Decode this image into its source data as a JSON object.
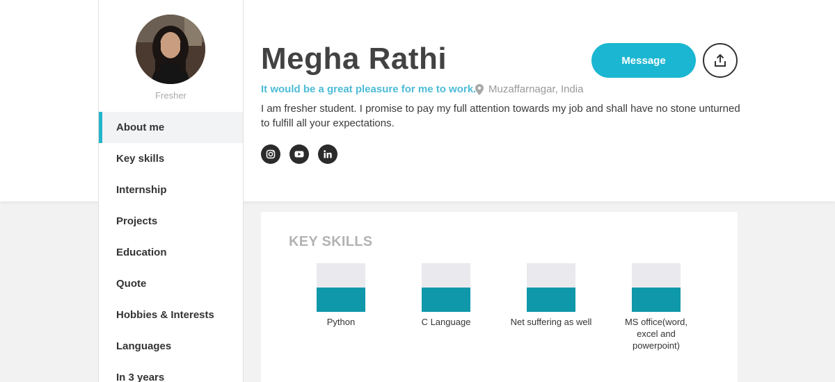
{
  "profile": {
    "status": "Fresher",
    "name": "Megha Rathi",
    "tagline": "It would be a great pleasure for me to work.",
    "location": "Muzaffarnagar, India",
    "bio": "I am fresher student. I promise to pay my full attention towards my job and shall have no stone unturned to fulfill all your expectations."
  },
  "actions": {
    "message_label": "Message"
  },
  "socials": [
    "instagram-icon",
    "youtube-icon",
    "linkedin-icon"
  ],
  "sidebar": {
    "items": [
      {
        "label": "About me",
        "active": true
      },
      {
        "label": "Key skills"
      },
      {
        "label": "Internship"
      },
      {
        "label": "Projects"
      },
      {
        "label": "Education"
      },
      {
        "label": "Quote"
      },
      {
        "label": "Hobbies & Interests"
      },
      {
        "label": "Languages"
      },
      {
        "label": "In 3 years"
      }
    ]
  },
  "skills_section": {
    "title": "KEY SKILLS",
    "skills": [
      {
        "label": "Python",
        "level": 0.5
      },
      {
        "label": "C Language",
        "level": 0.5
      },
      {
        "label": "Net suffering as well",
        "level": 0.5
      },
      {
        "label": "MS office(word, excel and powerpoint)",
        "level": 0.5
      }
    ]
  },
  "colors": {
    "accent": "#1bb6d1",
    "skill_fill": "#0f97aa",
    "tagline": "#4dbcd6"
  }
}
